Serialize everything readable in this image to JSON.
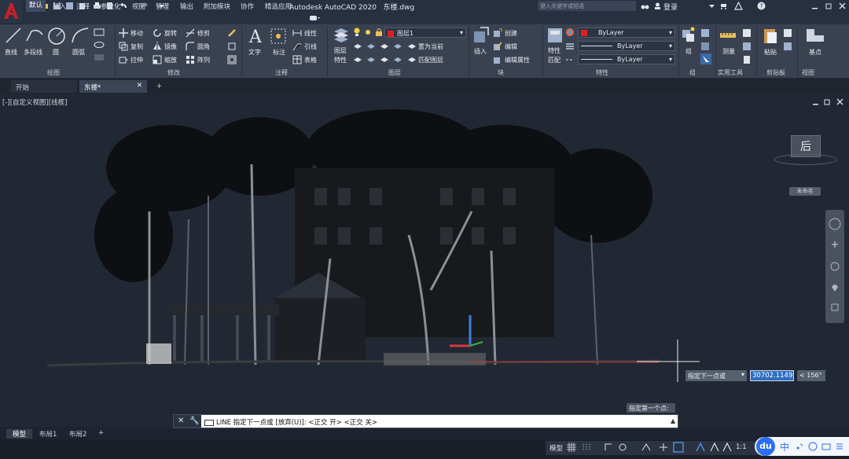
{
  "app": {
    "title": "Autodesk AutoCAD 2020",
    "file_name": "东楼.dwg",
    "logo_letter": "A",
    "search_placeholder": "键入关键字或短语",
    "login_label": "登录",
    "help_label": "?"
  },
  "menu_tabs": [
    "默认",
    "插入",
    "注释",
    "参数化",
    "视图",
    "管理",
    "输出",
    "附加模块",
    "协作",
    "精选应用"
  ],
  "ribbon": {
    "draw": {
      "panel": "绘图",
      "line": "直线",
      "polyline": "多段线",
      "circle": "圆",
      "arc": "圆弧"
    },
    "modify": {
      "panel": "修改",
      "move": "移动",
      "rotate": "旋转",
      "trim": "修剪",
      "copy": "复制",
      "mirror": "镜像",
      "fillet": "圆角",
      "stretch": "拉伸",
      "scale": "缩放",
      "array": "阵列"
    },
    "annotation": {
      "panel": "注释",
      "text": "文字",
      "dimension": "标注",
      "linear": "线性",
      "leader": "引线",
      "table": "表格"
    },
    "layers": {
      "panel": "图层",
      "properties_1": "图层",
      "properties_2": "特性",
      "current_layer": "图层1",
      "make_current": "置为当前",
      "match_layer": "匹配图层"
    },
    "block": {
      "panel": "块",
      "insert": "插入",
      "create": "创建",
      "edit": "编辑",
      "edit_attributes": "编辑属性"
    },
    "properties": {
      "panel": "特性",
      "match_1": "特性",
      "match_2": "匹配",
      "color": "ByLayer",
      "linetype": "ByLayer",
      "lineweight": "ByLayer"
    },
    "groups": {
      "panel": "组",
      "group": "组"
    },
    "utilities": {
      "panel": "实用工具",
      "measure": "测量"
    },
    "clipboard": {
      "panel": "剪贴板",
      "paste": "粘贴"
    },
    "view": {
      "panel": "视图",
      "base": "基点"
    }
  },
  "file_tabs": {
    "start": "开始",
    "current": "东楼*",
    "add": "+"
  },
  "viewport": {
    "label": "[-][自定义视图][线框]",
    "viewcube_face": "后",
    "ucs_name": "未命名",
    "dynamic_prompt": "指定下一点或",
    "dynamic_value": "30702.1149",
    "dynamic_angle": "< 156°",
    "first_point_tip": "指定第一个点:"
  },
  "command_line": {
    "text": "LINE 指定下一点或 [放弃(U)]:  <正交 开>  <正交 关>"
  },
  "layout_tabs": [
    "模型",
    "布局1",
    "布局2",
    "+"
  ],
  "status": {
    "model": "模型",
    "scale": "1:1",
    "ime_logo": "du",
    "ime_lang": "中"
  },
  "colors": {
    "accent": "#c8202a",
    "ribbon_bg": "#3a4252",
    "viewport_bg": "#212833",
    "dyn_input_bg": "#2f6fc1"
  }
}
